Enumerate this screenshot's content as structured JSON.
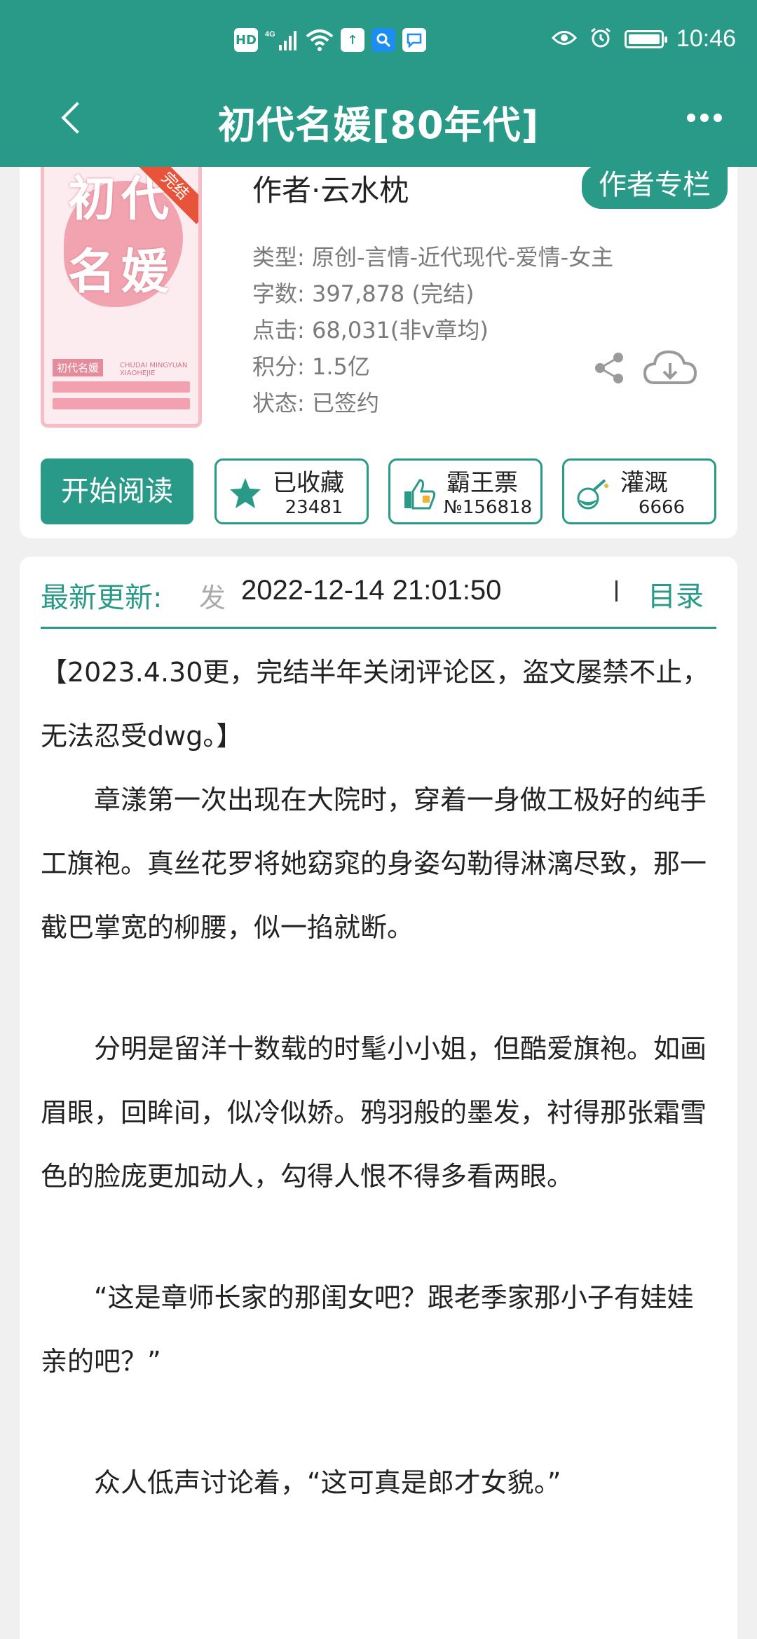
{
  "status": {
    "time": "10:46",
    "network": "4G",
    "hd": "HD"
  },
  "nav": {
    "title": "初代名媛[80年代]"
  },
  "book": {
    "cover": {
      "title": "初代名媛",
      "ribbon": "完结",
      "sub": "初代名媛",
      "sub_en": "CHUDAI MINGYUAN XIAOHEJIE"
    },
    "author": "作者·云水枕",
    "author_column": "作者专栏",
    "type": "类型: 原创-言情-近代现代-爱情-女主",
    "words": "字数: 397,878 (完结)",
    "clicks": "点击: 68,031(非v章均)",
    "score": "积分: 1.5亿",
    "state": "状态: 已签约"
  },
  "actions": {
    "read": "开始阅读",
    "collect": {
      "label": "已收藏",
      "count": "23481"
    },
    "vote": {
      "label": "霸王票",
      "count": "№156818"
    },
    "water": {
      "label": "灌溉",
      "count": "6666"
    }
  },
  "update": {
    "label": "最新更新:",
    "marquee": "发",
    "time": "2022-12-14 21:01:50",
    "catalog": "目录"
  },
  "content": {
    "p1": "【2023.4.30更，完结半年关闭评论区，盗文屡禁不止，无法忍受dwg。】",
    "p2": "章漾第一次出现在大院时，穿着一身做工极好的纯手工旗袍。真丝花罗将她窈窕的身姿勾勒得淋漓尽致，那一截巴掌宽的柳腰，似一掐就断。",
    "p3": "分明是留洋十数载的时髦小小姐，但酷爱旗袍。如画眉眼，回眸间，似冷似娇。鸦羽般的墨发，衬得那张霜雪色的脸庞更加动人，勾得人恨不得多看两眼。",
    "p4": "“这是章师长家的那闺女吧？跟老季家那小子有娃娃亲的吧？”",
    "p5": "众人低声讨论着，“这可真是郎才女貌。”"
  },
  "colors": {
    "accent": "#2a9a88",
    "cover_pink": "#f2a3b0",
    "ribbon": "#e8543a"
  }
}
